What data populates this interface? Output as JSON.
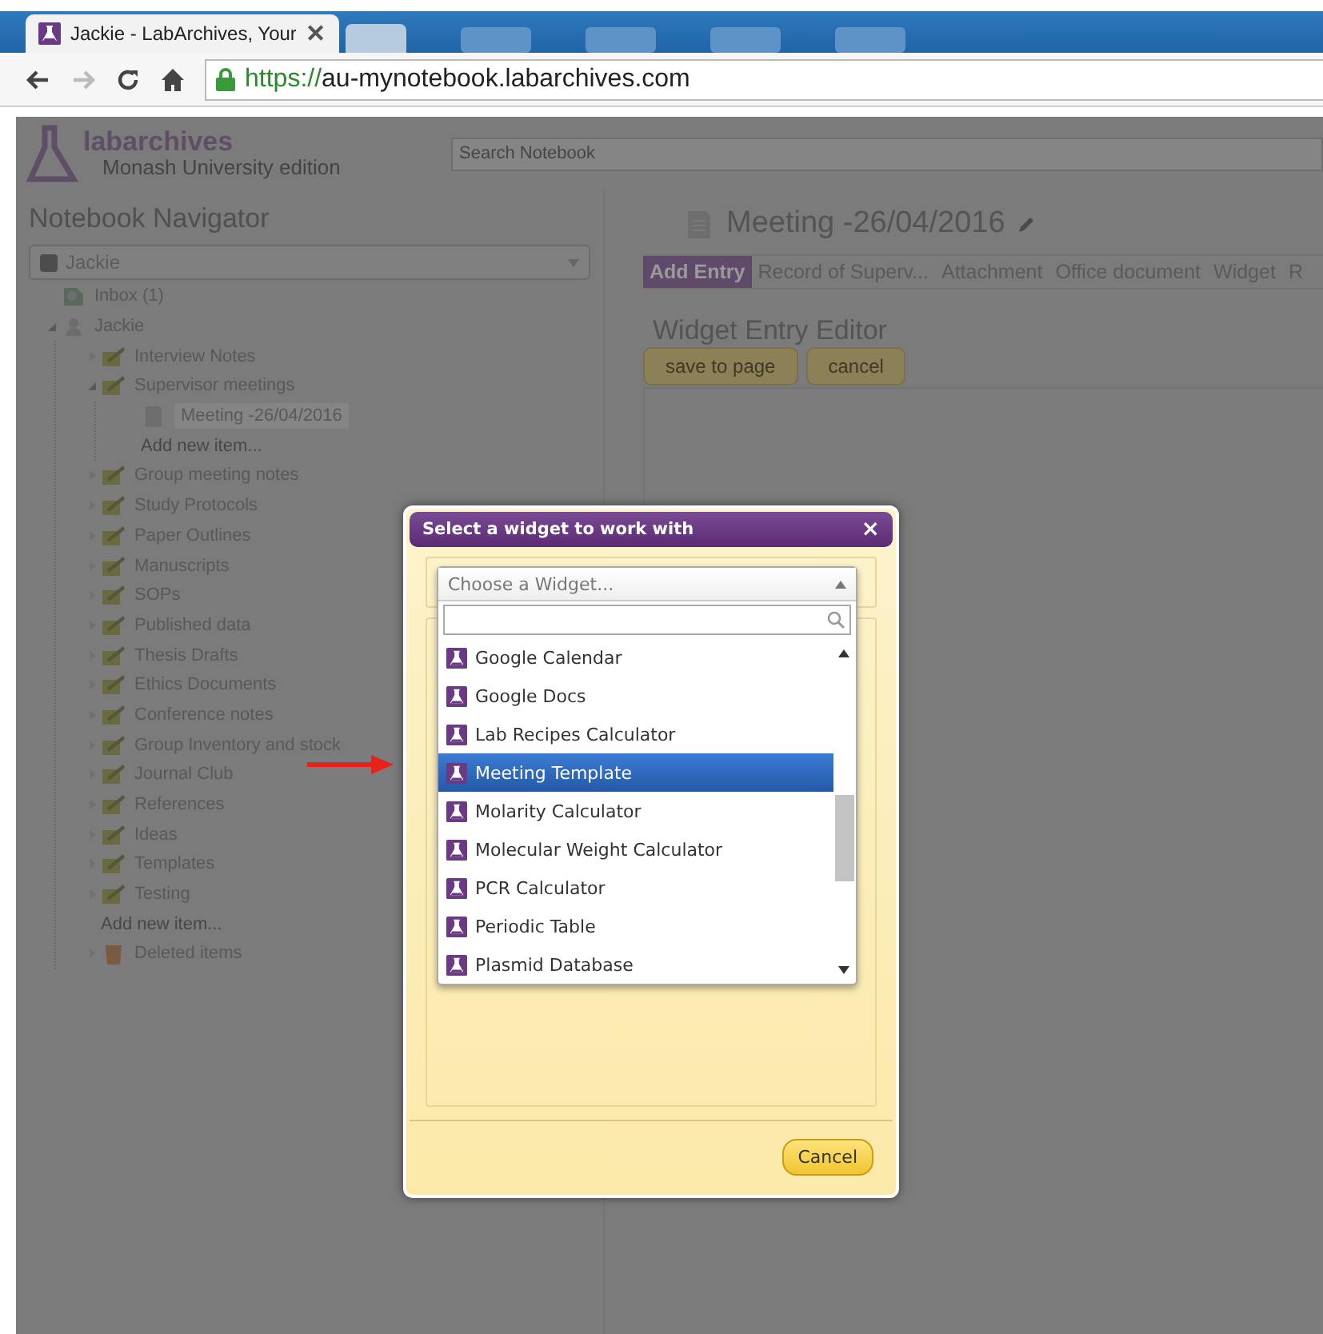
{
  "browser": {
    "tab_title": "Jackie - LabArchives, Your",
    "tab_close": "✕",
    "address_scheme": "https://",
    "address_host": "au-mynotebook.labarchives.com"
  },
  "header": {
    "logo_name": "labarchives",
    "edition": "Monash University edition",
    "search": {
      "placeholder": "Search Notebook"
    }
  },
  "navigator": {
    "title": "Notebook Navigator",
    "notebook_select": "Jackie",
    "tree": [
      {
        "kind": "inbox",
        "label": "Inbox (1)",
        "selected": false
      },
      {
        "kind": "user",
        "label": "Jackie",
        "selected": false,
        "expanded": true,
        "children": [
          {
            "kind": "folder",
            "label": "Interview Notes",
            "selected": false,
            "expanded": false
          },
          {
            "kind": "folder",
            "label": "Supervisor meetings",
            "selected": false,
            "expanded": true,
            "children": [
              {
                "kind": "page",
                "label": "Meeting -26/04/2016",
                "selected": true
              },
              {
                "kind": "add",
                "label": "Add new item...",
                "selected": false
              }
            ]
          },
          {
            "kind": "folder",
            "label": "Group meeting notes",
            "selected": false,
            "expanded": false
          },
          {
            "kind": "folder",
            "label": "Study Protocols",
            "selected": false,
            "expanded": false
          },
          {
            "kind": "folder",
            "label": "Paper Outlines",
            "selected": false,
            "expanded": false
          },
          {
            "kind": "folder",
            "label": "Manuscripts",
            "selected": false,
            "expanded": false
          },
          {
            "kind": "folder",
            "label": "SOPs",
            "selected": false,
            "expanded": false
          },
          {
            "kind": "folder",
            "label": "Published data",
            "selected": false,
            "expanded": false
          },
          {
            "kind": "folder",
            "label": "Thesis Drafts",
            "selected": false,
            "expanded": false
          },
          {
            "kind": "folder",
            "label": "Ethics Documents",
            "selected": false,
            "expanded": false
          },
          {
            "kind": "folder",
            "label": "Conference notes",
            "selected": false,
            "expanded": false
          },
          {
            "kind": "folder",
            "label": "Group Inventory and stock",
            "selected": false,
            "expanded": false
          },
          {
            "kind": "folder",
            "label": "Journal Club",
            "selected": false,
            "expanded": false
          },
          {
            "kind": "folder",
            "label": "References",
            "selected": false,
            "expanded": false
          },
          {
            "kind": "folder",
            "label": "Ideas",
            "selected": false,
            "expanded": false
          },
          {
            "kind": "folder",
            "label": "Templates",
            "selected": false,
            "expanded": false
          },
          {
            "kind": "folder",
            "label": "Testing",
            "selected": false,
            "expanded": false
          },
          {
            "kind": "add",
            "label": "Add new item...",
            "selected": false
          },
          {
            "kind": "trash",
            "label": "Deleted items",
            "selected": false,
            "expanded": false
          }
        ]
      }
    ]
  },
  "page": {
    "title": "Meeting -26/04/2016",
    "entry_tabs": [
      {
        "label": "Add Entry",
        "selected": true
      },
      {
        "label": "Record of Superv...",
        "selected": false
      },
      {
        "label": "Attachment",
        "selected": false
      },
      {
        "label": "Office document",
        "selected": false
      },
      {
        "label": "Widget",
        "selected": false
      },
      {
        "label": "R",
        "selected": false
      }
    ],
    "editor_title": "Widget Entry Editor",
    "buttons": [
      "save to page",
      "cancel"
    ]
  },
  "dialog": {
    "title": "Select a widget to work with",
    "close": "×",
    "select_placeholder": "Choose a Widget...",
    "options": [
      {
        "label": "Google Calendar",
        "selected": false
      },
      {
        "label": "Google Docs",
        "selected": false
      },
      {
        "label": "Lab Recipes Calculator",
        "selected": false
      },
      {
        "label": "Meeting Template",
        "selected": true
      },
      {
        "label": "Molarity Calculator",
        "selected": false
      },
      {
        "label": "Molecular Weight Calculator",
        "selected": false
      },
      {
        "label": "PCR Calculator",
        "selected": false
      },
      {
        "label": "Periodic Table",
        "selected": false
      },
      {
        "label": "Plasmid Database",
        "selected": false
      }
    ],
    "cancel": "Cancel"
  }
}
